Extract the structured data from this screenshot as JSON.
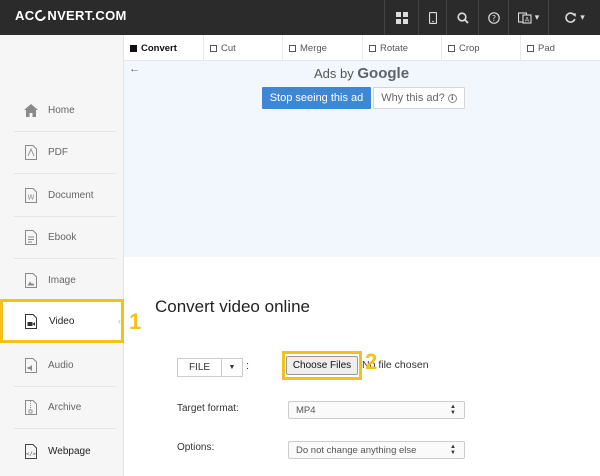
{
  "brand": {
    "logo_left": "AC",
    "logo_right": "NVERT.COM"
  },
  "topnav": {
    "icons": [
      "grid-icon",
      "mobile-icon",
      "search-icon",
      "help-icon",
      "language-icon",
      "converter-switch-icon"
    ],
    "dropdown_caret": "▾"
  },
  "sidebar": {
    "items": [
      {
        "label": "Home",
        "icon": "home-icon"
      },
      {
        "label": "PDF",
        "icon": "pdf-icon"
      },
      {
        "label": "Document",
        "icon": "document-icon"
      },
      {
        "label": "Ebook",
        "icon": "ebook-icon"
      },
      {
        "label": "Image",
        "icon": "image-icon"
      },
      {
        "label": "Video",
        "icon": "video-icon",
        "active": true
      },
      {
        "label": "Audio",
        "icon": "audio-icon"
      },
      {
        "label": "Archive",
        "icon": "archive-icon"
      },
      {
        "label": "Webpage",
        "icon": "webpage-icon"
      }
    ]
  },
  "tabs": [
    {
      "label": "Convert",
      "active": true
    },
    {
      "label": "Cut"
    },
    {
      "label": "Merge"
    },
    {
      "label": "Rotate"
    },
    {
      "label": "Crop"
    },
    {
      "label": "Pad"
    }
  ],
  "ad": {
    "back": "←",
    "ads_by": "Ads by",
    "google": "Google",
    "stop_label": "Stop seeing this ad",
    "why_label": "Why this ad?",
    "why_icon": "ℹ"
  },
  "main": {
    "title": "Convert video online",
    "file_button": "FILE",
    "file_caret": "▼",
    "colon": ":",
    "choose_files": "Choose Files",
    "no_file_text": "No file chosen",
    "target_format_label": "Target format:",
    "target_format_value": "MP4",
    "options_label": "Options:",
    "options_value": "Do not change anything else",
    "select_arrows": "▲\n▼"
  },
  "annotations": {
    "callout_1": "1",
    "callout_2": "2"
  },
  "colors": {
    "topbar": "#2b2b2b",
    "highlight": "#f3c21a",
    "ad_button": "#3e86d6",
    "ad_bg": "#f1f7fd"
  }
}
